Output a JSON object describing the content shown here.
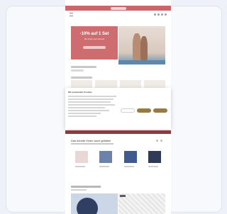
{
  "promo_bar": {
    "color": "#c9676b"
  },
  "hero": {
    "title": "-10% auf 1 Set",
    "subtitle": "Bis Ende des Monats",
    "background": "#cd6d70"
  },
  "cookie_banner": {
    "title": "Wir verwenden Cookies"
  },
  "products_section": {
    "heading": "Das könnte Ihnen auch gefallen"
  },
  "icons": [
    "menu-icon",
    "search-icon",
    "account-icon",
    "wishlist-icon",
    "cart-icon"
  ]
}
